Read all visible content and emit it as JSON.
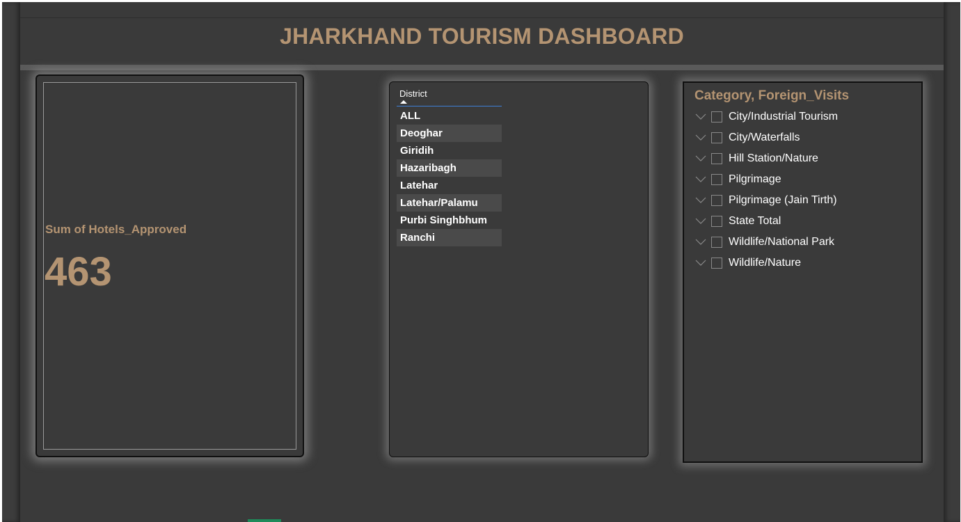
{
  "header": {
    "title": "JHARKHAND TOURISM DASHBOARD"
  },
  "kpi": {
    "label": "Sum of Hotels_Approved",
    "value": "463"
  },
  "district_slicer": {
    "header": "District",
    "items": [
      {
        "label": "ALL"
      },
      {
        "label": "Deoghar"
      },
      {
        "label": "Giridih"
      },
      {
        "label": "Hazaribagh"
      },
      {
        "label": "Latehar"
      },
      {
        "label": "Latehar/Palamu"
      },
      {
        "label": "Purbi Singhbhum"
      },
      {
        "label": "Ranchi"
      }
    ]
  },
  "category_slicer": {
    "title": "Category, Foreign_Visits",
    "items": [
      {
        "label": "City/Industrial Tourism"
      },
      {
        "label": "City/Waterfalls"
      },
      {
        "label": "Hill Station/Nature"
      },
      {
        "label": "Pilgrimage"
      },
      {
        "label": "Pilgrimage (Jain Tirth)"
      },
      {
        "label": "State Total"
      },
      {
        "label": "Wildlife/National Park"
      },
      {
        "label": "Wildlife/Nature"
      }
    ]
  },
  "colors": {
    "accent": "#b49472",
    "background": "#3a3a3a",
    "slicer_alt_row": "#4a4a4a",
    "underline": "#3f7fd6"
  }
}
